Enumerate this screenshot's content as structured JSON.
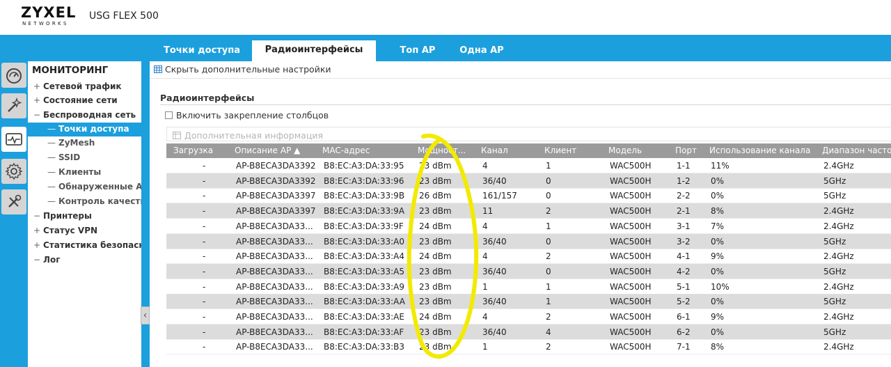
{
  "header": {
    "logo_main": "ZYXEL",
    "logo_sub": "NETWORKS",
    "model": "USG FLEX 500"
  },
  "tabs": [
    {
      "label": "Точки доступа",
      "active": false
    },
    {
      "label": "Радиоинтерфейсы",
      "active": true
    },
    {
      "label": "Топ AP",
      "active": false
    },
    {
      "label": "Одна AP",
      "active": false
    }
  ],
  "nav_icons": [
    "dashboard-icon",
    "wand-icon",
    "monitor-icon",
    "gear-icon",
    "tools-icon"
  ],
  "menu": {
    "title": "МОНИТОРИНГ",
    "items": [
      {
        "label": "Сетевой трафик",
        "prefix": "+"
      },
      {
        "label": "Состояние сети",
        "prefix": "+"
      },
      {
        "label": "Беспроводная сеть",
        "prefix": "−"
      }
    ],
    "subitems": [
      {
        "label": "Точки доступа",
        "active": true
      },
      {
        "label": "ZyMesh",
        "active": false
      },
      {
        "label": "SSID",
        "active": false
      },
      {
        "label": "Клиенты",
        "active": false
      },
      {
        "label": "Обнаруженные AP",
        "active": false
      },
      {
        "label": "Контроль качества",
        "active": false
      }
    ],
    "items2": [
      {
        "label": "Принтеры",
        "prefix": "−"
      },
      {
        "label": "Статус VPN",
        "prefix": "+"
      },
      {
        "label": "Статистика безопасности",
        "prefix": "+"
      },
      {
        "label": "Лог",
        "prefix": "−"
      }
    ],
    "collapse_glyph": "‹"
  },
  "content": {
    "hide_advanced": "Скрыть дополнительные настройки",
    "section_title": "Радиоинтерфейсы",
    "freeze_columns": "Включить закрепление столбцов",
    "more_info": "Дополнительная информация"
  },
  "table": {
    "columns": [
      "Загрузка",
      "Описание AP ▲",
      "MAC-адрес",
      "Мощност...",
      "Канал",
      "Клиент",
      "Модель",
      "Порт",
      "Использование канала",
      "Диапазон частот"
    ],
    "rows": [
      [
        "-",
        "AP-B8ECA3DA3392",
        "B8:EC:A3:DA:33:95",
        "23 dBm",
        "4",
        "1",
        "WAC500H",
        "1-1",
        "11%",
        "2.4GHz"
      ],
      [
        "-",
        "AP-B8ECA3DA3392",
        "B8:EC:A3:DA:33:96",
        "23 dBm",
        "36/40",
        "0",
        "WAC500H",
        "1-2",
        "0%",
        "5GHz"
      ],
      [
        "-",
        "AP-B8ECA3DA3397",
        "B8:EC:A3:DA:33:9B",
        "26 dBm",
        "161/157",
        "0",
        "WAC500H",
        "2-2",
        "0%",
        "5GHz"
      ],
      [
        "-",
        "AP-B8ECA3DA3397",
        "B8:EC:A3:DA:33:9A",
        "23 dBm",
        "11",
        "2",
        "WAC500H",
        "2-1",
        "8%",
        "2.4GHz"
      ],
      [
        "-",
        "AP-B8ECA3DA33...",
        "B8:EC:A3:DA:33:9F",
        "24 dBm",
        "4",
        "1",
        "WAC500H",
        "3-1",
        "7%",
        "2.4GHz"
      ],
      [
        "-",
        "AP-B8ECA3DA33...",
        "B8:EC:A3:DA:33:A0",
        "23 dBm",
        "36/40",
        "0",
        "WAC500H",
        "3-2",
        "0%",
        "5GHz"
      ],
      [
        "-",
        "AP-B8ECA3DA33...",
        "B8:EC:A3:DA:33:A4",
        "24 dBm",
        "4",
        "2",
        "WAC500H",
        "4-1",
        "9%",
        "2.4GHz"
      ],
      [
        "-",
        "AP-B8ECA3DA33...",
        "B8:EC:A3:DA:33:A5",
        "23 dBm",
        "36/40",
        "0",
        "WAC500H",
        "4-2",
        "0%",
        "5GHz"
      ],
      [
        "-",
        "AP-B8ECA3DA33...",
        "B8:EC:A3:DA:33:A9",
        "23 dBm",
        "1",
        "1",
        "WAC500H",
        "5-1",
        "10%",
        "2.4GHz"
      ],
      [
        "-",
        "AP-B8ECA3DA33...",
        "B8:EC:A3:DA:33:AA",
        "23 dBm",
        "36/40",
        "1",
        "WAC500H",
        "5-2",
        "0%",
        "5GHz"
      ],
      [
        "-",
        "AP-B8ECA3DA33...",
        "B8:EC:A3:DA:33:AE",
        "24 dBm",
        "4",
        "2",
        "WAC500H",
        "6-1",
        "9%",
        "2.4GHz"
      ],
      [
        "-",
        "AP-B8ECA3DA33...",
        "B8:EC:A3:DA:33:AF",
        "23 dBm",
        "36/40",
        "4",
        "WAC500H",
        "6-2",
        "0%",
        "5GHz"
      ],
      [
        "-",
        "AP-B8ECA3DA33...",
        "B8:EC:A3:DA:33:B3",
        "23 dBm",
        "1",
        "2",
        "WAC500H",
        "7-1",
        "8%",
        "2.4GHz"
      ]
    ]
  },
  "colors": {
    "brand_blue": "#1c9fdd",
    "header_gray": "#9b9b9b",
    "row_alt": "#dcdcdc",
    "annotation_yellow": "#f2ea00"
  }
}
